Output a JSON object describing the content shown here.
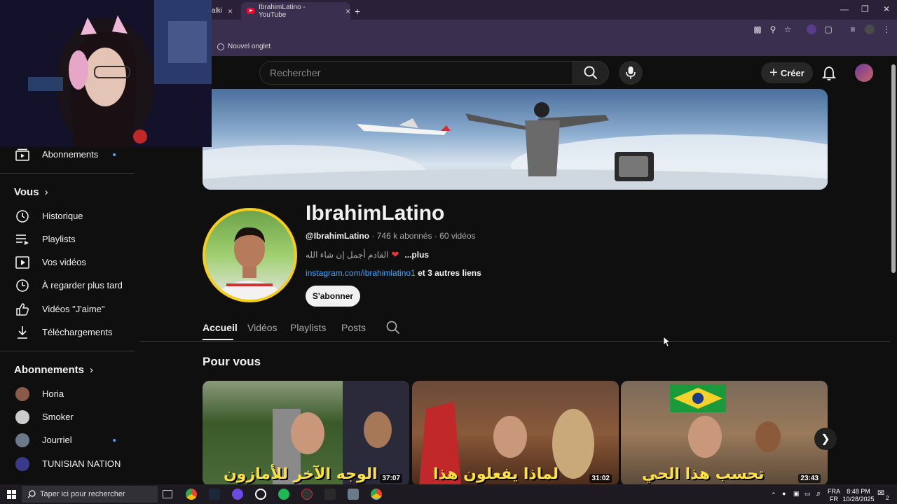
{
  "browser": {
    "tab_partial": "alki",
    "tab_active": "IbrahimLatino - YouTube",
    "tab_close": "×",
    "new_tab": "+",
    "bookmark": "Nouvel onglet"
  },
  "header": {
    "search_placeholder": "Rechercher",
    "create_label": "Créer"
  },
  "sidebar": {
    "subscriptions_top": "Abonnements",
    "you_heading": "Vous",
    "you_items": [
      {
        "label": "Historique",
        "icon": "history-icon"
      },
      {
        "label": "Playlists",
        "icon": "playlist-icon"
      },
      {
        "label": "Vos vidéos",
        "icon": "your-videos-icon"
      },
      {
        "label": "À regarder plus tard",
        "icon": "watch-later-icon"
      },
      {
        "label": "Vidéos \"J'aime\"",
        "icon": "like-icon"
      },
      {
        "label": "Téléchargements",
        "icon": "download-icon"
      }
    ],
    "subs_heading": "Abonnements",
    "subs": [
      {
        "label": "Horia",
        "color": "#8a5a4a"
      },
      {
        "label": "Smoker",
        "color": "#cccccc"
      },
      {
        "label": "Jourriel",
        "color": "#6a7a8a"
      },
      {
        "label": "TUNISIAN NATION",
        "color": "#3a3a8a"
      }
    ]
  },
  "channel": {
    "name": "IbrahimLatino",
    "handle": "@IbrahimLatino",
    "subscribers": "746 k abonnés",
    "videos": "60 vidéos",
    "separator": "·",
    "description": "القادم أجمل إن شاء الله",
    "more": "...plus",
    "link": "instagram.com/ibrahimlatino1",
    "other_links": "et 3 autres liens",
    "subscribe": "S'abonner"
  },
  "tabs": [
    "Accueil",
    "Vidéos",
    "Playlists",
    "Posts"
  ],
  "section_title": "Pour vous",
  "videos": [
    {
      "caption": "الوجه الآخر للأمازون",
      "duration": "37:07"
    },
    {
      "caption": "لماذا يفعلون هذا",
      "duration": "31:02"
    },
    {
      "caption": "تحسب هذا الحي",
      "duration": "23:43"
    }
  ],
  "taskbar": {
    "search_placeholder": "Taper ici pour rechercher",
    "lang_top": "FRA",
    "lang_bottom": "FR",
    "time": "8:48 PM",
    "date": "10/28/2025",
    "notif_count": "2"
  },
  "colors": {
    "accent_link": "#3ea6ff",
    "avatar_ring": "#f6cd1e",
    "background": "#0f0f0f"
  }
}
